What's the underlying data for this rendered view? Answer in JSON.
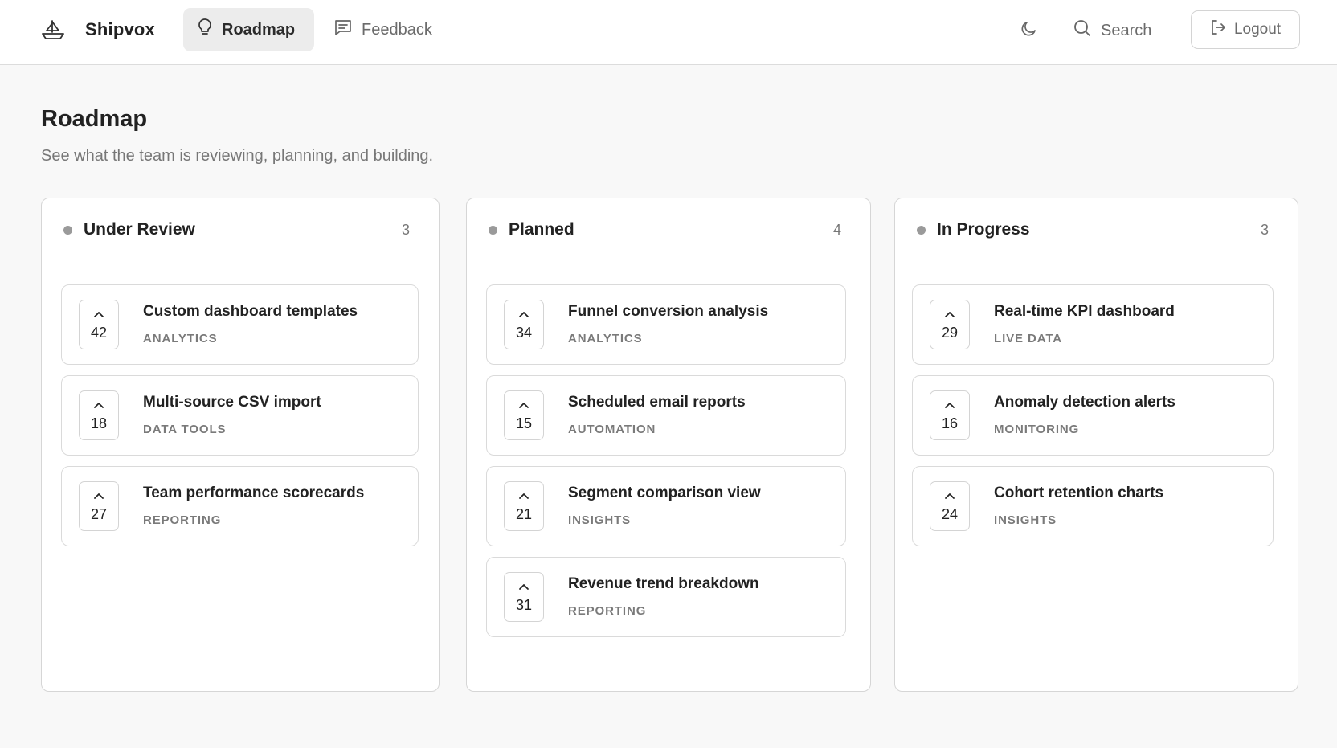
{
  "app": {
    "name": "Shipvox"
  },
  "nav": {
    "items": [
      {
        "label": "Roadmap",
        "icon": "lightbulb-icon",
        "active": true
      },
      {
        "label": "Feedback",
        "icon": "message-square-icon",
        "active": false
      }
    ]
  },
  "header": {
    "search_label": "Search",
    "logout_label": "Logout",
    "theme_icon": "moon-icon"
  },
  "page": {
    "title": "Roadmap",
    "subtitle": "See what the team is reviewing, planning, and building."
  },
  "columns": [
    {
      "title": "Under Review",
      "count": "3",
      "cards": [
        {
          "title": "Custom dashboard templates",
          "tag": "ANALYTICS",
          "votes": "42"
        },
        {
          "title": "Multi-source CSV import",
          "tag": "DATA TOOLS",
          "votes": "18"
        },
        {
          "title": "Team performance scorecards",
          "tag": "REPORTING",
          "votes": "27"
        }
      ]
    },
    {
      "title": "Planned",
      "count": "4",
      "cards": [
        {
          "title": "Funnel conversion analysis",
          "tag": "ANALYTICS",
          "votes": "34"
        },
        {
          "title": "Scheduled email reports",
          "tag": "AUTOMATION",
          "votes": "15"
        },
        {
          "title": "Segment comparison view",
          "tag": "INSIGHTS",
          "votes": "21"
        },
        {
          "title": "Revenue trend breakdown",
          "tag": "REPORTING",
          "votes": "31"
        }
      ]
    },
    {
      "title": "In Progress",
      "count": "3",
      "cards": [
        {
          "title": "Real-time KPI dashboard",
          "tag": "LIVE DATA",
          "votes": "29"
        },
        {
          "title": "Anomaly detection alerts",
          "tag": "MONITORING",
          "votes": "16"
        },
        {
          "title": "Cohort retention charts",
          "tag": "INSIGHTS",
          "votes": "24"
        }
      ]
    }
  ]
}
